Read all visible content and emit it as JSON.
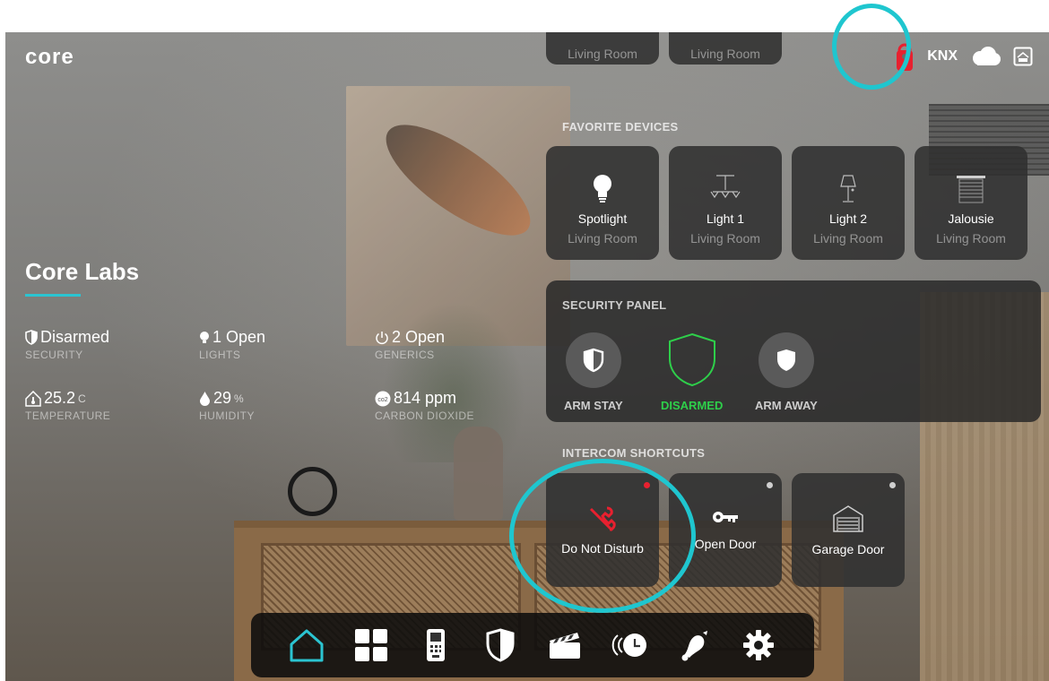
{
  "app": {
    "logo": "core"
  },
  "topbar": {
    "knx_label": "KNX"
  },
  "site": {
    "name": "Core Labs"
  },
  "stats": {
    "security": {
      "value": "Disarmed",
      "label": "SECURITY"
    },
    "lights": {
      "value": "1 Open",
      "label": "LIGHTS"
    },
    "generics": {
      "value": "2 Open",
      "label": "GENERICS"
    },
    "temperature": {
      "value": "25.2",
      "unit": "C",
      "label": "TEMPERATURE"
    },
    "humidity": {
      "value": "29",
      "unit": "%",
      "label": "HUMIDITY"
    },
    "co2": {
      "value": "814 ppm",
      "badge": "co2",
      "label": "CARBON DIOXIDE"
    }
  },
  "partial_tiles": [
    "Living Room",
    "Living Room"
  ],
  "favorites": {
    "title": "FAVORITE DEVICES",
    "items": [
      {
        "name": "Spotlight",
        "room": "Living Room",
        "icon": "bulb-icon"
      },
      {
        "name": "Light 1",
        "room": "Living Room",
        "icon": "chandelier-icon"
      },
      {
        "name": "Light 2",
        "room": "Living Room",
        "icon": "floor-lamp-icon"
      },
      {
        "name": "Jalousie",
        "room": "Living Room",
        "icon": "blinds-icon"
      }
    ]
  },
  "security_panel": {
    "title": "SECURITY PANEL",
    "buttons": [
      {
        "label": "ARM STAY",
        "active": false
      },
      {
        "label": "DISARMED",
        "active": true
      },
      {
        "label": "ARM AWAY",
        "active": false
      }
    ]
  },
  "intercom": {
    "title": "INTERCOM SHORTCUTS",
    "items": [
      {
        "name": "Do Not Disturb",
        "icon": "do-not-disturb-icon",
        "dot": "red"
      },
      {
        "name": "Open Door",
        "icon": "key-icon",
        "dot": "grey"
      },
      {
        "name": "Garage Door",
        "icon": "garage-icon",
        "dot": "grey"
      }
    ]
  },
  "nav": [
    "home",
    "dashboard",
    "intercom",
    "security",
    "scenes",
    "timers",
    "alarm",
    "settings"
  ],
  "colors": {
    "accent": "#2bc4d1",
    "disarmed_green": "#2ecf4a",
    "dnd_red": "#e8202f",
    "annotation": "#1fc6cf"
  }
}
